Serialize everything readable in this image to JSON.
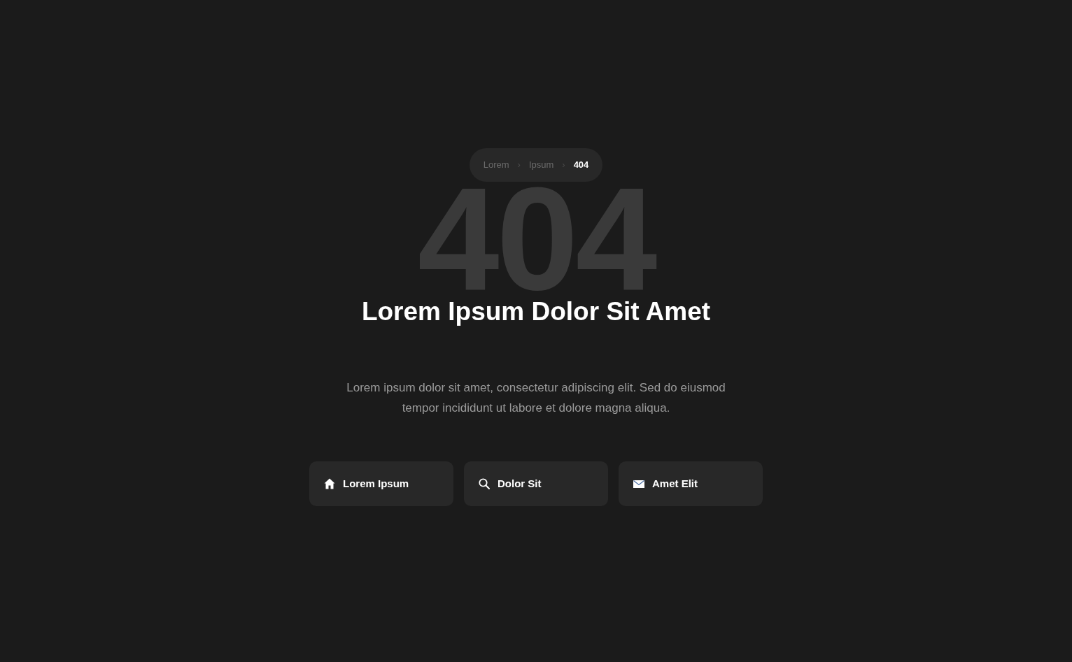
{
  "breadcrumb": [
    {
      "label": "Lorem",
      "current": false
    },
    {
      "separator": "›"
    },
    {
      "label": "Ipsum",
      "current": false
    },
    {
      "separator": "›"
    },
    {
      "label": "404",
      "current": true
    }
  ],
  "backdrop_code": "404",
  "heading": "Lorem Ipsum Dolor Sit Amet",
  "description": "Lorem ipsum dolor sit amet, consectetur adipiscing elit. Sed do eiusmod tempor incididunt ut labore et dolore magna aliqua.",
  "actions": [
    {
      "kind": "home",
      "label": "Lorem Ipsum"
    },
    {
      "kind": "search",
      "label": "Dolor Sit"
    },
    {
      "kind": "mail",
      "label": "Amet Elit"
    }
  ]
}
